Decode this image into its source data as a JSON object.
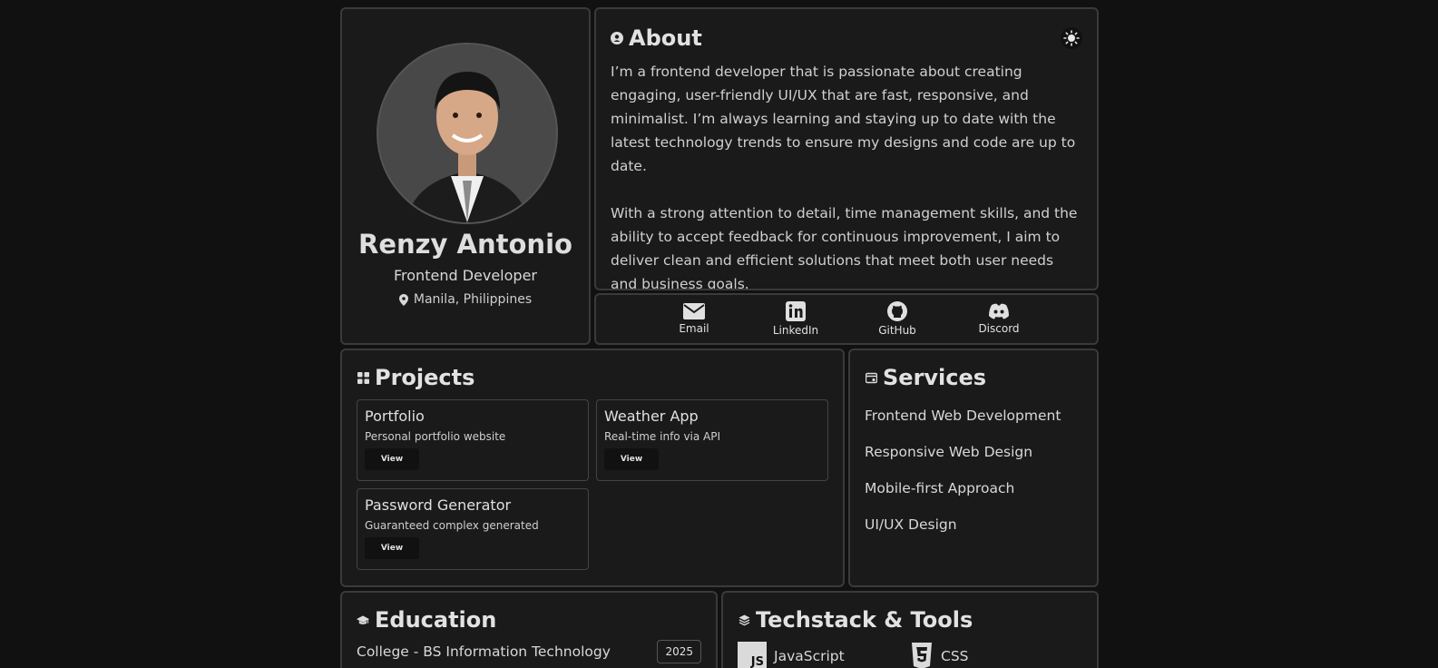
{
  "profile": {
    "name": "Renzy Antonio",
    "role": "Frontend Developer",
    "location": "Manila, Philippines"
  },
  "about": {
    "title": "About",
    "paragraphs": [
      "I’m a frontend developer that is passionate about creating engaging, user-friendly UI/UX that are fast, responsive, and minimalist. I’m always learning and staying up to date with the latest technology trends to ensure my designs and code are up to date.",
      "With a strong attention to detail, time management skills, and the ability to accept feedback for continuous improvement, I aim to deliver clean and efficient solutions that meet both user needs and business goals."
    ]
  },
  "socials": [
    {
      "label": "Email",
      "icon": "envelope-icon"
    },
    {
      "label": "LinkedIn",
      "icon": "linkedin-icon"
    },
    {
      "label": "GitHub",
      "icon": "github-icon"
    },
    {
      "label": "Discord",
      "icon": "discord-icon"
    }
  ],
  "projects": {
    "title": "Projects",
    "items": [
      {
        "title": "Portfolio",
        "desc": "Personal portfolio website",
        "button": "View"
      },
      {
        "title": "Weather App",
        "desc": "Real-time info via API",
        "button": "View"
      },
      {
        "title": "Password Generator",
        "desc": "Guaranteed complex generated",
        "button": "View"
      }
    ]
  },
  "services": {
    "title": "Services",
    "items": [
      "Frontend Web Development",
      "Responsive Web Design",
      "Mobile-first Approach",
      "UI/UX Design"
    ]
  },
  "education": {
    "title": "Education",
    "degree": "College - BS Information Technology",
    "year": "2025"
  },
  "tech": {
    "title": "Techstack & Tools",
    "items": [
      {
        "label": "JavaScript",
        "badge": "JS"
      },
      {
        "label": "CSS",
        "badge": ""
      }
    ]
  },
  "colors": {
    "background": "#111111",
    "card": "#1a1a1a",
    "border": "#3a3a3a"
  }
}
